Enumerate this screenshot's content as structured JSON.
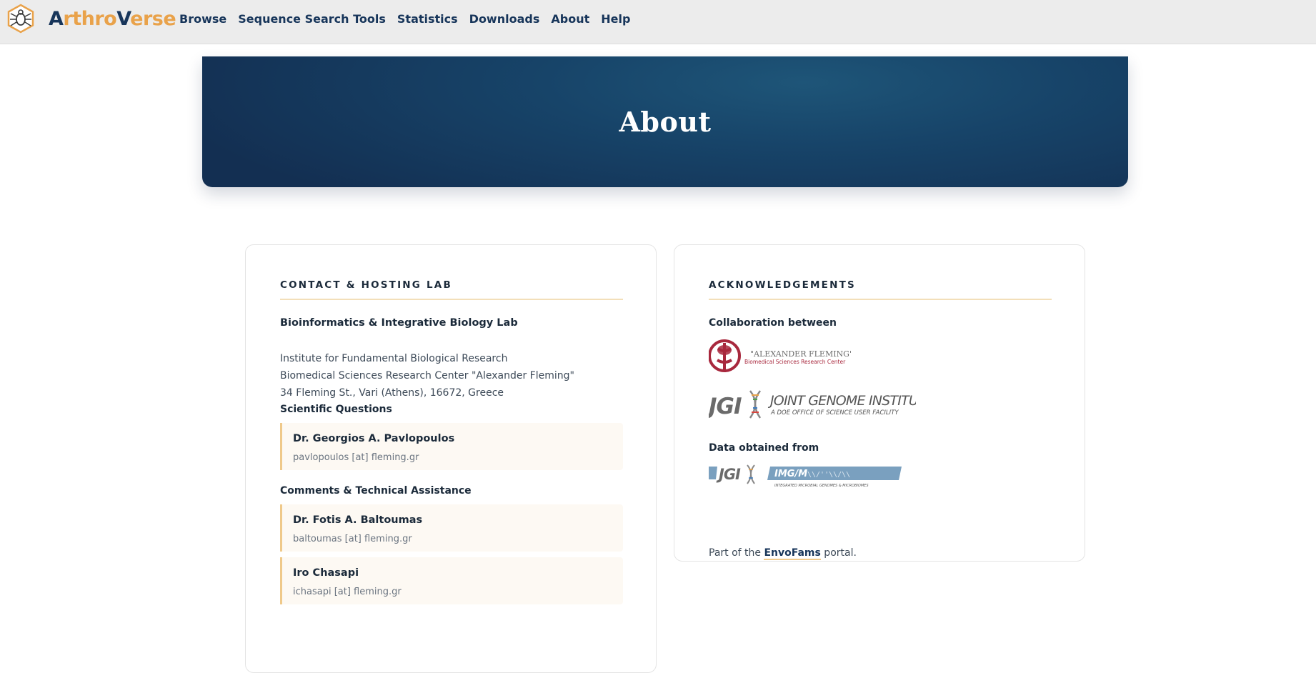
{
  "nav": {
    "brand": {
      "first": "A",
      "second": "rthro",
      "third": "V",
      "fourth": "erse"
    },
    "links": [
      "Browse",
      "Sequence Search Tools",
      "Statistics",
      "Downloads",
      "About",
      "Help"
    ]
  },
  "hero": {
    "title": "About"
  },
  "contact": {
    "heading": "CONTACT & HOSTING LAB",
    "lab_name": "Bioinformatics & Integrative Biology Lab",
    "address": [
      "Institute for Fundamental Biological Research",
      "Biomedical Sciences Research Center \"Alexander Fleming\"",
      "34 Fleming St., Vari (Athens), 16672, Greece"
    ],
    "scientific_title": "Scientific Questions",
    "scientific_people": [
      {
        "name": "Dr. Georgios A. Pavlopoulos",
        "email": "pavlopoulos [at] fleming.gr"
      }
    ],
    "technical_title": "Comments & Technical Assistance",
    "technical_people": [
      {
        "name": "Dr. Fotis A. Baltoumas",
        "email": "baltoumas [at] fleming.gr"
      },
      {
        "name": "Iro Chasapi",
        "email": "ichasapi [at] fleming.gr"
      }
    ]
  },
  "ack": {
    "heading": "ACKNOWLEDGEMENTS",
    "collab_title": "Collaboration between",
    "fleming_logo": {
      "line1": "\"ALEXANDER FLEMING\"",
      "line2": "Biomedical Sciences Research Center"
    },
    "jgi_logo": {
      "mark": "JGI",
      "line1": "JOINT GENOME INSTITUTE",
      "line2": "A DOE OFFICE OF SCIENCE USER FACILITY"
    },
    "data_title": "Data obtained from",
    "img_logo": {
      "mark": "JGI",
      "label": "IMG/M",
      "sub": "INTEGRATED MICROBIAL GENOMES & MICROBIOMES"
    },
    "part_of_prefix": "Part of the ",
    "part_of_link": "EnvoFams",
    "part_of_suffix": " portal."
  },
  "colors": {
    "navy": "#17355a",
    "accent": "#e9a24a",
    "card_highlight": "#fdf9f3",
    "fleming_red": "#a8283d",
    "img_blue": "#7aa0bf"
  }
}
